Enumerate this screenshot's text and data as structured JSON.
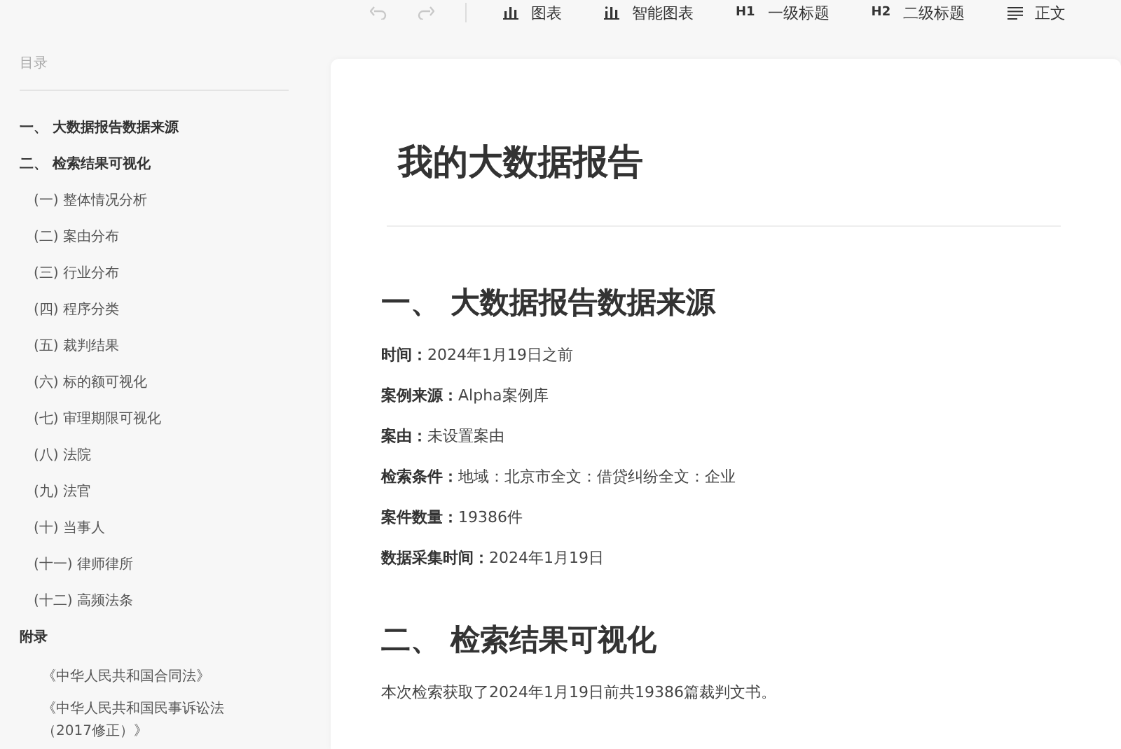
{
  "toolbar": {
    "history": [
      {
        "kind": "undo",
        "disabled": true
      },
      {
        "kind": "redo",
        "disabled": true
      }
    ],
    "items": [
      {
        "kind": "chart",
        "label": "图表"
      },
      {
        "kind": "smart-chart",
        "label": "智能图表"
      },
      {
        "kind": "heading",
        "badge": "H1",
        "label": "一级标题"
      },
      {
        "kind": "heading",
        "badge": "H2",
        "label": "二级标题"
      },
      {
        "kind": "paragraph",
        "label": "正文"
      }
    ]
  },
  "sidebar": {
    "title": "目录",
    "toc": [
      {
        "label": "一、 大数据报告数据来源"
      },
      {
        "label": "二、 检索结果可视化",
        "children": [
          {
            "label": "(一) 整体情况分析"
          },
          {
            "label": "(二) 案由分布"
          },
          {
            "label": "(三) 行业分布"
          },
          {
            "label": "(四) 程序分类"
          },
          {
            "label": "(五) 裁判结果"
          },
          {
            "label": "(六) 标的额可视化"
          },
          {
            "label": "(七) 审理期限可视化"
          },
          {
            "label": "(八) 法院"
          },
          {
            "label": "(九) 法官"
          },
          {
            "label": "(十) 当事人"
          },
          {
            "label": "(十一) 律师律所"
          },
          {
            "label": "(十二) 高频法条"
          }
        ]
      },
      {
        "label": "附录",
        "children": [
          {
            "label": "《中华人民共和国合同法》"
          },
          {
            "label": "《中华人民共和国民事诉讼法（2017修正）》"
          }
        ]
      }
    ]
  },
  "document": {
    "title": "我的大数据报告",
    "sections": [
      {
        "heading": "一、 大数据报告数据来源",
        "fields": [
          {
            "label": "时间：",
            "value": "2024年1月19日之前"
          },
          {
            "label": "案例来源：",
            "value": "Alpha案例库"
          },
          {
            "label": "案由：",
            "value": "未设置案由"
          },
          {
            "label": "检索条件：",
            "value": "地域：北京市全文：借贷纠纷全文：企业"
          },
          {
            "label": "案件数量：",
            "value": "19386件"
          },
          {
            "label": "数据采集时间：",
            "value": "2024年1月19日"
          }
        ]
      },
      {
        "heading": "二、 检索结果可视化",
        "paragraph": "本次检索获取了2024年1月19日前共19386篇裁判文书。"
      }
    ]
  }
}
